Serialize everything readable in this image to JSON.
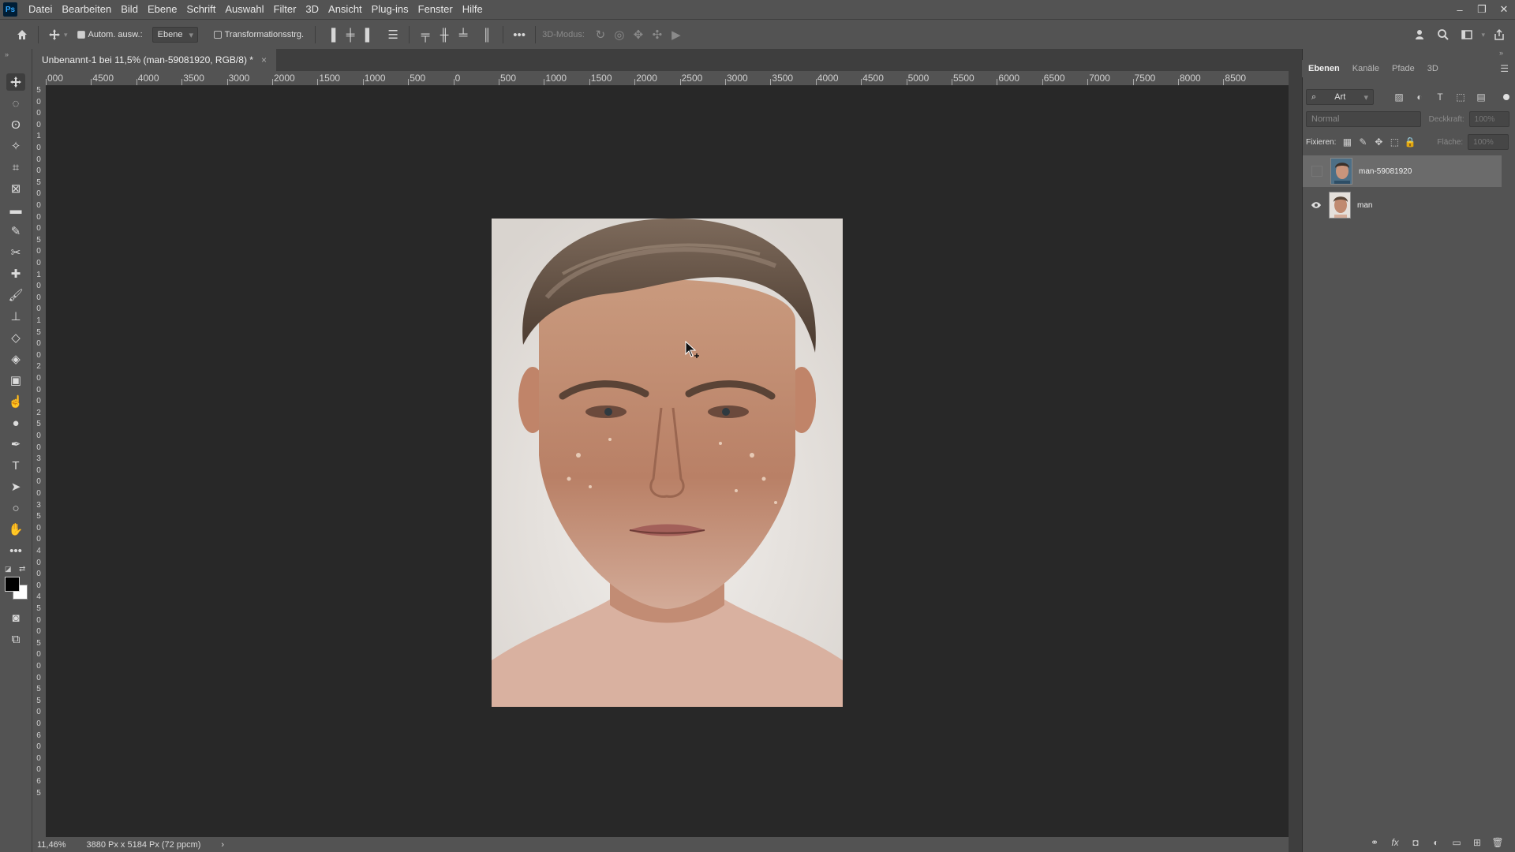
{
  "app": {
    "logo": "Ps"
  },
  "menu": [
    "Datei",
    "Bearbeiten",
    "Bild",
    "Ebene",
    "Schrift",
    "Auswahl",
    "Filter",
    "3D",
    "Ansicht",
    "Plug-ins",
    "Fenster",
    "Hilfe"
  ],
  "window_controls": {
    "minimize": "–",
    "restore": "❐",
    "close": "✕"
  },
  "options": {
    "auto_select_label": "Autom. ausw.:",
    "auto_select_checked": true,
    "target_value": "Ebene",
    "transform_label": "Transformationsstrg.",
    "mode3d_label": "3D-Modus:",
    "more": "•••"
  },
  "document": {
    "tab_title": "Unbenannt-1 bei 11,5% (man-59081920, RGB/8) *",
    "close": "×"
  },
  "ruler_h": [
    "000",
    "4500",
    "4000",
    "3500",
    "3000",
    "2000",
    "1500",
    "1000",
    "500",
    "0",
    "500",
    "1000",
    "1500",
    "2000",
    "2500",
    "3000",
    "3500",
    "4000",
    "4500",
    "5000",
    "5500",
    "6000",
    "6500",
    "7000",
    "7500",
    "8000",
    "8500"
  ],
  "ruler_v": [
    "5",
    "0",
    "0",
    "0",
    "1",
    "0",
    "0",
    "0",
    "5",
    "0",
    "0",
    "0",
    "0",
    "5",
    "0",
    "0",
    "1",
    "0",
    "0",
    "0",
    "1",
    "5",
    "0",
    "0",
    "2",
    "0",
    "0",
    "0",
    "2",
    "5",
    "0",
    "0",
    "3",
    "0",
    "0",
    "0",
    "3",
    "5",
    "0",
    "0",
    "4",
    "0",
    "0",
    "0",
    "4",
    "5",
    "0",
    "0",
    "5",
    "0",
    "0",
    "0",
    "5",
    "5",
    "0",
    "0",
    "6",
    "0",
    "0",
    "0",
    "6",
    "5"
  ],
  "status": {
    "zoom": "11,46%",
    "doc_info": "3880 Px x 5184 Px (72 ppcm)",
    "arrow": "›"
  },
  "panel": {
    "tabs": [
      "Ebenen",
      "Kanäle",
      "Pfade",
      "3D"
    ],
    "filter_kind": "Art",
    "blend_mode": "Normal",
    "opacity_label": "Deckkraft:",
    "opacity_value": "100%",
    "lock_label": "Fixieren:",
    "fill_label": "Fläche:",
    "fill_value": "100%",
    "layers": [
      {
        "name": "man-59081920",
        "visible": false,
        "selected": true
      },
      {
        "name": "man",
        "visible": true,
        "selected": false
      }
    ]
  },
  "colors": {
    "ui_bg": "#535353",
    "canvas_bg": "#282828",
    "dark": "#3e3e3e"
  }
}
